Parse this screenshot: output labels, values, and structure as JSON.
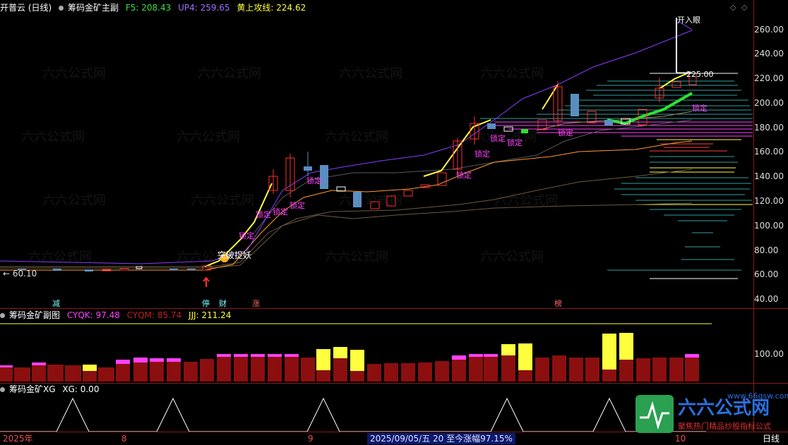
{
  "main_panel": {
    "title": "开普云 (日线)",
    "indicator": "筹码金矿主副",
    "f5": "F5: 208.43",
    "up4": "UP4: 259.65",
    "golden": "黄上攻线: 224.62",
    "low_label": "← 60.10",
    "high_label": "开入眼",
    "price_label": "225.00",
    "annotations": {
      "breakout": "突破捉妖",
      "lock": "锁定",
      "lock2": "锁定"
    },
    "axis_ticks": [
      "260.00",
      "240.00",
      "220.00",
      "200.00",
      "180.00",
      "160.00",
      "140.00",
      "120.00",
      "100.00",
      "80.00",
      "60.00",
      "40.00"
    ],
    "bottom_tags": [
      {
        "name": "减",
        "color": "#7ff"
      },
      {
        "name": "停",
        "color": "#7ff"
      },
      {
        "name": "财",
        "color": "#7ff"
      },
      {
        "name": "涨",
        "color": "#f66"
      },
      {
        "name": "榜",
        "color": "#f66"
      }
    ]
  },
  "sub_panel": {
    "indicator": "筹码金矿副图",
    "cyqk": "CYQK: 97.48",
    "cyqm": "CYQM: 85.74",
    "jjj": "JJJ: 211.24",
    "axis_tick": "100.00"
  },
  "xg_panel": {
    "indicator": "筹码金矿XG",
    "xg": "XG: 0.00"
  },
  "x_axis": {
    "year": "2025年",
    "m8": "8",
    "m9": "9",
    "m10": "10",
    "period": "日线",
    "cursor": "2025/09/05/五 20 至今涨幅97.15%"
  },
  "watermark": {
    "brand": "六六公式网",
    "slogan": "聚焦热门精品炒股指标公式",
    "url": "www.66gsw.com"
  },
  "colors": {
    "up": "#ff3030",
    "down": "#5a8ec0",
    "ma_yellow": "#ffff40",
    "ma_purple": "#8a3cff",
    "ma_orange": "#ff9a30",
    "green": "#30e030",
    "magenta": "#ff40ff",
    "cyan": "#30c0c0"
  }
}
